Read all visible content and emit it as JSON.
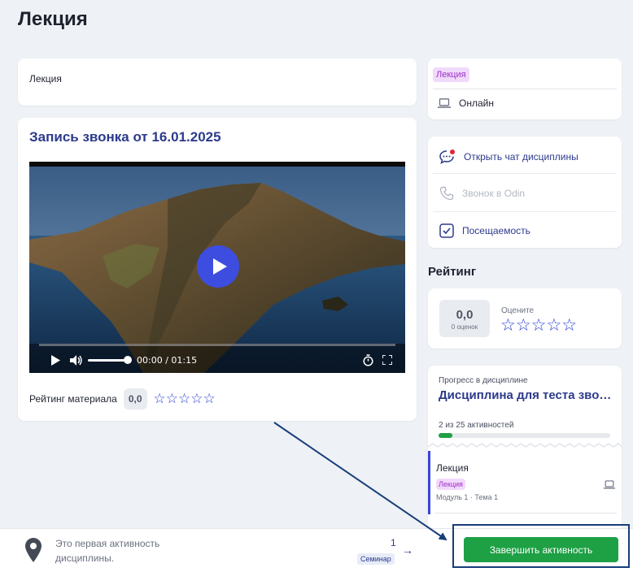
{
  "page": {
    "title": "Лекция"
  },
  "description": {
    "text": "Лекция"
  },
  "video_card": {
    "title": "Запись звонка от 16.01.2025",
    "time": "00:00 / 01:15",
    "rating_label": "Рейтинг материала",
    "rating_value": "0,0",
    "stars": "☆☆☆☆☆"
  },
  "activity_info": {
    "type_tag": "Лекция",
    "format": "Онлайн"
  },
  "actions": [
    {
      "label": "Открыть чат дисциплины",
      "enabled": true
    },
    {
      "label": "Звонок в Odin",
      "enabled": false
    },
    {
      "label": "Посещаемость",
      "enabled": true
    }
  ],
  "rating": {
    "heading": "Рейтинг",
    "score": "0,0",
    "count": "0 оценок",
    "rate_label": "Оцените",
    "stars": "☆☆☆☆☆"
  },
  "progress": {
    "label": "Прогресс в дисциплине",
    "title": "Дисциплина для теста звонков",
    "count_text": "2 из 25 активностей",
    "fraction": 0.08,
    "item": {
      "title": "Лекция",
      "tag": "Лекция",
      "meta": "Модуль 1 · Тема 1"
    }
  },
  "bottom_bar": {
    "message": "Это первая активность дисциплины.",
    "next_number": "1",
    "next_type": "Семинар",
    "finish_label": "Завершить активность"
  },
  "colors": {
    "accent": "#2b40d6",
    "title_blue": "#2c3a8c",
    "success": "#1ea045",
    "tag_bg": "#f1d9fb",
    "tag_fg": "#9d2fc9"
  }
}
